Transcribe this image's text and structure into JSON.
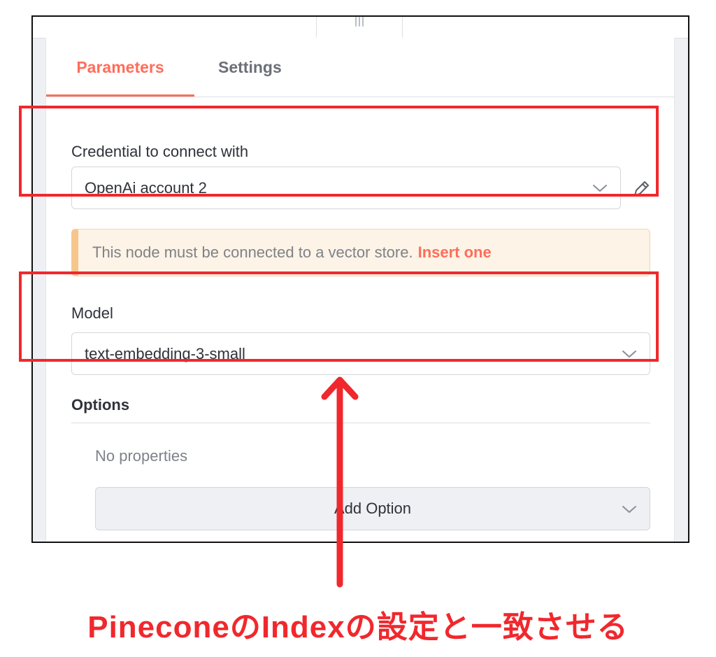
{
  "tabs": [
    {
      "label": "Parameters",
      "active": true
    },
    {
      "label": "Settings",
      "active": false
    }
  ],
  "credential": {
    "label": "Credential to connect with",
    "value": "OpenAi account 2"
  },
  "notice": {
    "text": "This node must be connected to a vector store.",
    "link": "Insert one"
  },
  "model": {
    "label": "Model",
    "value": "text-embedding-3-small"
  },
  "options": {
    "title": "Options",
    "empty_text": "No properties",
    "add_label": "Add Option"
  },
  "annotation": {
    "caption": "PineconeのIndexの設定と一致させる",
    "color": "#f0282d"
  },
  "colors": {
    "accent": "#ff6d5a",
    "notice_bg": "#fdf3e6"
  },
  "icons": [
    "drag-handle-icon",
    "chevron-down-icon",
    "pencil-icon",
    "arrow-up-icon"
  ]
}
